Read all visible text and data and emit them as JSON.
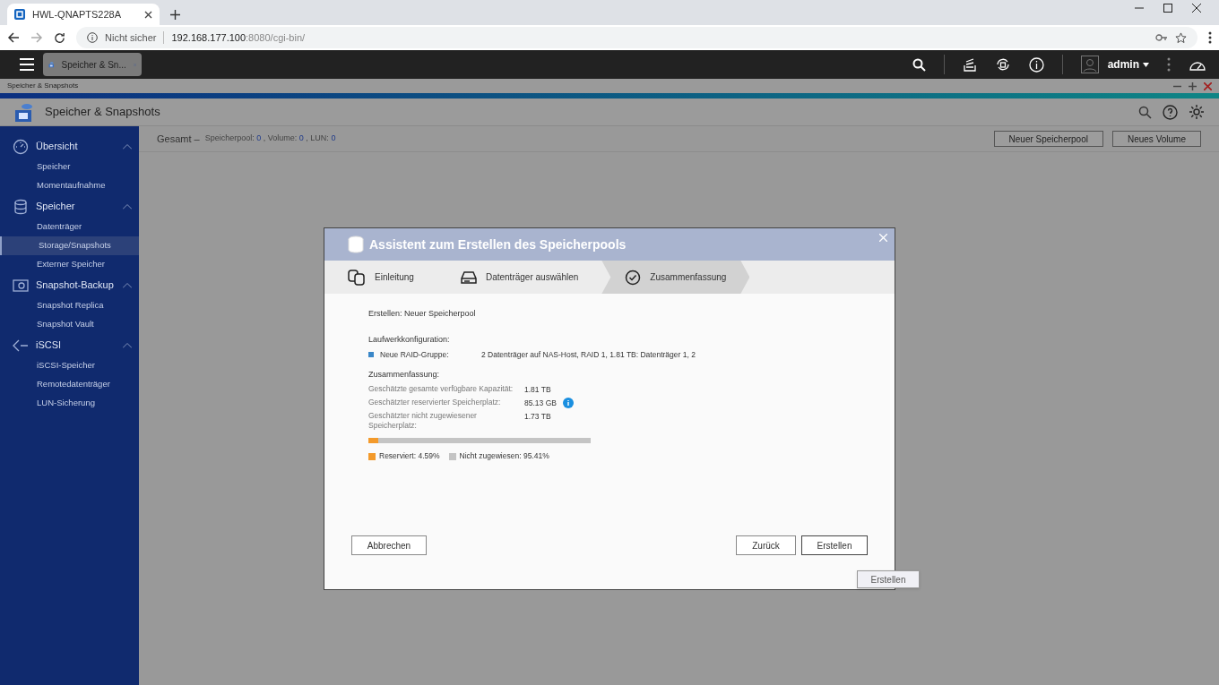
{
  "browser": {
    "tab_title": "HWL-QNAPTS228A",
    "security": "Nicht sicher",
    "host": "192.168.177.100",
    "path": ":8080/cgi-bin/"
  },
  "topbar": {
    "app_tab": "Speicher & Sn...",
    "user": "admin"
  },
  "app_strip_title": "Speicher & Snapshots",
  "app_header": {
    "title": "Speicher & Snapshots"
  },
  "sidebar": [
    {
      "label": "Übersicht",
      "expanded": true,
      "items": [
        {
          "label": "Speicher",
          "selected": false
        },
        {
          "label": "Momentaufnahme",
          "selected": false
        }
      ]
    },
    {
      "label": "Speicher",
      "expanded": true,
      "items": [
        {
          "label": "Datenträger",
          "selected": false
        },
        {
          "label": "Storage/Snapshots",
          "selected": true
        },
        {
          "label": "Externer Speicher",
          "selected": false
        }
      ]
    },
    {
      "label": "Snapshot-Backup",
      "expanded": true,
      "items": [
        {
          "label": "Snapshot Replica",
          "selected": false
        },
        {
          "label": "Snapshot Vault",
          "selected": false
        }
      ]
    },
    {
      "label": "iSCSI",
      "expanded": true,
      "items": [
        {
          "label": "iSCSI-Speicher",
          "selected": false
        },
        {
          "label": "Remotedatenträger",
          "selected": false
        },
        {
          "label": "LUN-Sicherung",
          "selected": false
        }
      ]
    }
  ],
  "summary": {
    "title": "Gesamt –",
    "stats": [
      {
        "label": "Speicherpool:",
        "value": "0"
      },
      {
        "label": ", Volume:",
        "value": "0"
      },
      {
        "label": ", LUN:",
        "value": "0"
      }
    ]
  },
  "toolbar_buttons": [
    "Neuer Speicherpool",
    "Neues Volume"
  ],
  "dialog": {
    "title": "Assistent zum Erstellen des Speicherpools",
    "steps": [
      {
        "label": "Einleitung",
        "selected": false
      },
      {
        "label": "Datenträger auswählen",
        "selected": false
      },
      {
        "label": "Zusammenfassung",
        "selected": true
      }
    ],
    "heading": "Erstellen: Neuer Speicherpool",
    "config_heading": "Laufwerkkonfiguration:",
    "raid_group": {
      "label": "Neue RAID-Gruppe:",
      "value": "2 Datenträger auf NAS-Host, RAID 1, 1.81 TB: Datenträger 1, 2",
      "color": "#3a87c8"
    },
    "summary_heading": "Zusammenfassung:",
    "rows": [
      {
        "label": "Geschätzte gesamte verfügbare Kapazität:",
        "value": "1.81 TB",
        "info": false
      },
      {
        "label": "Geschätzter reservierter Speicherplatz:",
        "value": "85.13 GB",
        "info": true
      },
      {
        "label": "Geschätzter nicht zugewiesener Speicherplatz:",
        "value": "1.73 TB",
        "info": false
      }
    ],
    "usage": {
      "level": 0.0459,
      "legend": [
        {
          "label": "Reserviert: 4.59%",
          "color": "#f39a2b"
        },
        {
          "label": "Nicht zugewiesen: 95.41%",
          "color": "#c4c4c4"
        }
      ]
    },
    "cancel": "Abbrechen",
    "buttons": [
      "Zurück",
      "Erstellen"
    ],
    "tooltip": "Erstellen"
  }
}
